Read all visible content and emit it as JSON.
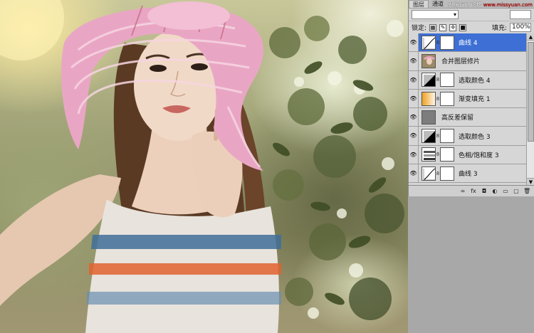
{
  "panel": {
    "tabs": [
      "图层",
      "通道"
    ],
    "brand": "思缘设计论坛",
    "brand_url": "www.missyuan.com",
    "blend_mode": "",
    "opacity_label": "",
    "opacity_value": "",
    "lock_label": "锁定:",
    "fill_label": "填充:",
    "fill_value": "100%",
    "layers": [
      {
        "name": "曲线 4",
        "thumb": "curves-icon",
        "mask": true,
        "active": true
      },
      {
        "name": "合并图层修片",
        "thumb": "photo-thumb",
        "mask": false,
        "active": false
      },
      {
        "name": "选取颜色 4",
        "thumb": "selective-color-icon",
        "mask": true,
        "active": false
      },
      {
        "name": "渐变填充 1",
        "thumb": "gradient-icon",
        "mask": true,
        "active": false
      },
      {
        "name": "高反差保留",
        "thumb": "gray-thumb",
        "mask": false,
        "active": false
      },
      {
        "name": "选取颜色 3",
        "thumb": "selective-color-icon",
        "mask": true,
        "active": false
      },
      {
        "name": "色相/饱和度 3",
        "thumb": "hue-saturation-icon",
        "mask": true,
        "active": false
      },
      {
        "name": "曲线 3",
        "thumb": "curves-icon",
        "mask": true,
        "active": false
      }
    ],
    "bottom_icons": [
      "link-icon",
      "fx-icon",
      "mask-icon",
      "adjustment-icon",
      "folder-icon",
      "new-layer-icon",
      "trash-icon"
    ],
    "bottom_glyphs": [
      "∞",
      "fx",
      "◘",
      "◐",
      "▭",
      "▢",
      "🗑"
    ]
  },
  "colors": {
    "selection": "#3d6fd4",
    "panel_bg": "#d6d6d6",
    "hat_pink": "#e9a6c4"
  }
}
